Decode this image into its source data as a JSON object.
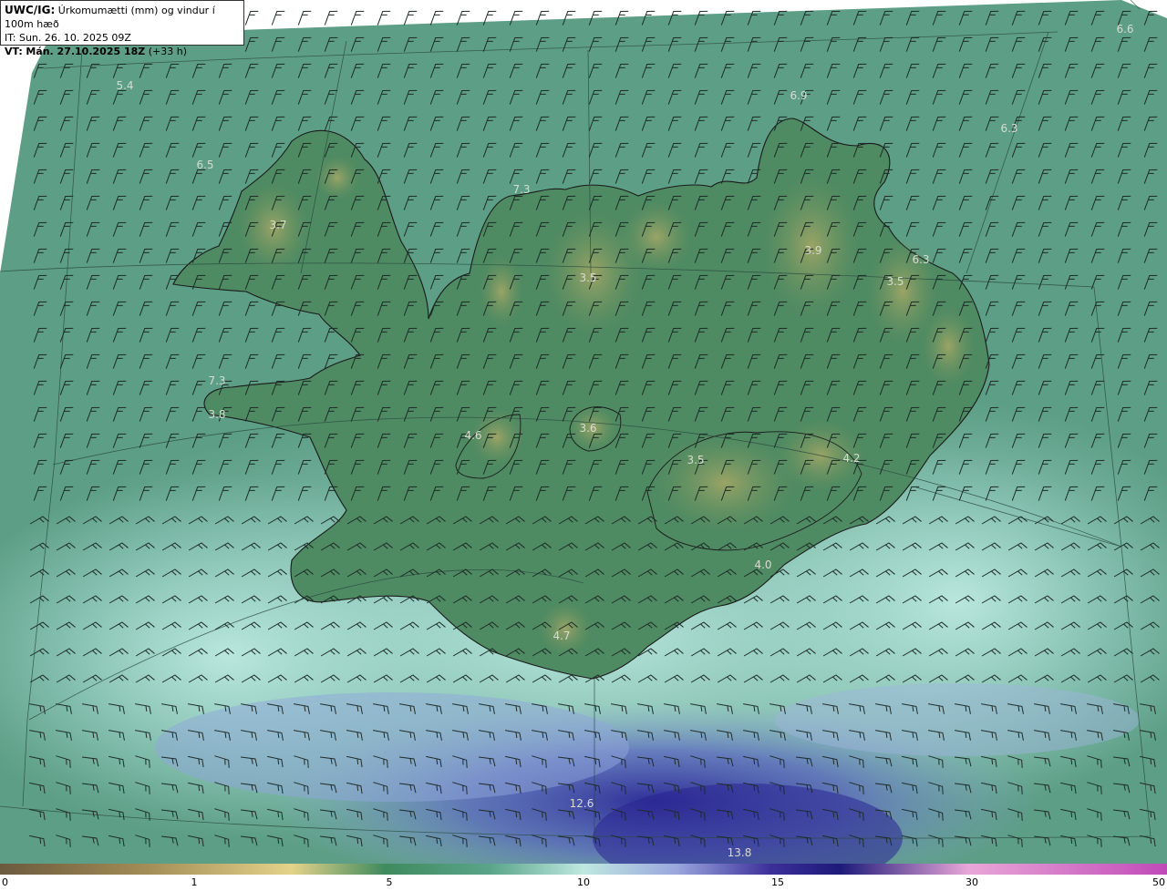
{
  "header": {
    "model": "UWC/IG:",
    "title": "Úrkomumætti (mm) og vindur í 100m hæð",
    "issue_time": "IT: Sun. 26. 10. 2025 09Z",
    "valid_prefix": "VT:",
    "valid_time": "Mán. 27.10.2025 18Z",
    "lead": "(+33 h)"
  },
  "value_labels": [
    "6.6",
    "5.4",
    "6.9",
    "6.3",
    "6.5",
    "7.3",
    "3.7",
    "3.9",
    "6.3",
    "3.5",
    "3.5",
    "7.3",
    "3.8",
    "4.6",
    "3.6",
    "3.5",
    "4.2",
    "4.0",
    "4.7",
    "12.6",
    "13.8"
  ],
  "colorbar": {
    "ticks": [
      "0",
      "1",
      "5",
      "10",
      "15",
      "30",
      "50"
    ],
    "colors": [
      "#6b5a3e",
      "#a08a55",
      "#e4d38a",
      "#3f8a5e",
      "#5aa58a",
      "#bfe8e0",
      "#9aa6de",
      "#3c2f9a",
      "#1d1a7a",
      "#e9a7d8",
      "#c04ab8"
    ]
  },
  "colors": {
    "land": "#4f8c63",
    "highland": "#8c9c5a",
    "sea": "#5e9f88",
    "rain_light": "#a9e0d7",
    "rain_heavy": "#5b5fc2",
    "coast": "#1a1a1a"
  }
}
